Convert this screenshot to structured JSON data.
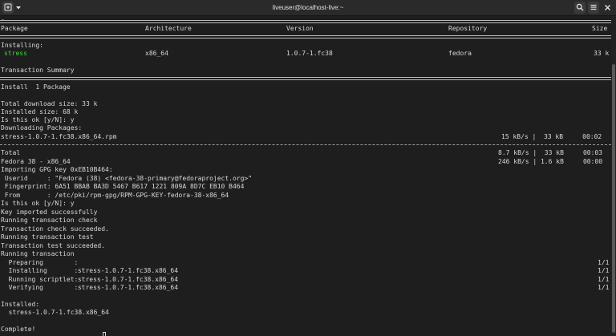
{
  "window": {
    "title": "liveuser@localhost-live:~",
    "new_tab_icon": "new-tab-icon",
    "menu_dropdown_icon": "chevron-down-icon",
    "search_icon": "search-icon",
    "menu_icon": "hamburger-icon",
    "close_icon": "close-icon"
  },
  "colors": {
    "background": "#1e1e1e",
    "foreground": "#d8d8d8",
    "package_highlight": "#3fd13f",
    "titlebar": "#2a2a2a"
  },
  "terminal": {
    "top_fragment": "-",
    "header": {
      "package": "Package",
      "architecture": "Architecture",
      "version": "Version",
      "repository": "Repository",
      "size": "Size"
    },
    "installing_label": "Installing:",
    "package_row": {
      "name": "stress",
      "arch": "x86_64",
      "version": "1.0.7-1.fc38",
      "repo": "fedora",
      "size": "33 k"
    },
    "transaction_summary": "Transaction Summary",
    "install_count": "Install  1 Package",
    "total_download": "Total download size: 33 k",
    "installed_size": "Installed size: 68 k",
    "prompt1": "Is this ok [y/N]: y",
    "downloading": "Downloading Packages:",
    "rpm_file": "stress-1.0.7-1.fc38.x86_64.rpm",
    "rpm_stats": "15 kB/s |  33 kB     00:02",
    "total_label": "Total",
    "total_stats": "8.7 kB/s |  33 kB     00:03",
    "repo_line": "Fedora 38 - x86_64",
    "repo_stats": "246 kB/s | 1.6 kB     00:00",
    "gpg_import": "Importing GPG key 0xEB10B464:",
    "gpg_userid": " Userid     : \"Fedora (38) <fedora-38-primary@fedoraproject.org>\"",
    "gpg_fingerprint": " Fingerprint: 6A51 BBAB BA3D 5467 B617 1221 809A 8D7C EB10 B464",
    "gpg_from": " From       : /etc/pki/rpm-gpg/RPM-GPG-KEY-fedora-38-x86_64",
    "prompt2": "Is this ok [y/N]: y",
    "key_imported": "Key imported successfully",
    "running_check": "Running transaction check",
    "check_succeeded": "Transaction check succeeded.",
    "running_test": "Running transaction test",
    "test_succeeded": "Transaction test succeeded.",
    "running_transaction": "Running transaction",
    "steps": [
      {
        "label": "  Preparing        :",
        "detail": "",
        "count": "1/1"
      },
      {
        "label": "  Installing       :",
        "detail": " stress-1.0.7-1.fc38.x86_64",
        "count": "1/1"
      },
      {
        "label": "  Running scriptlet:",
        "detail": " stress-1.0.7-1.fc38.x86_64",
        "count": "1/1"
      },
      {
        "label": "  Verifying        :",
        "detail": " stress-1.0.7-1.fc38.x86_64",
        "count": "1/1"
      }
    ],
    "installed_label": "Installed:",
    "installed_pkg": "  stress-1.0.7-1.fc38.x86_64",
    "complete": "Complete!"
  }
}
